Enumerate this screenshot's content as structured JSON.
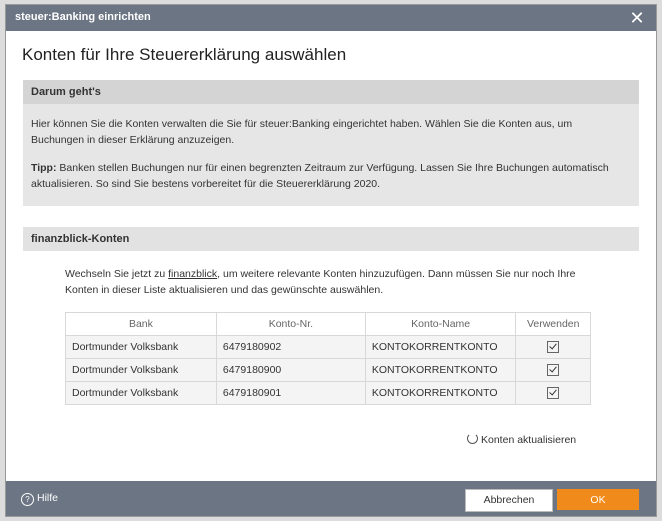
{
  "window": {
    "title": "steuer:Banking einrichten",
    "close_glyph": "✕"
  },
  "heading": "Konten für Ihre Steuererklärung auswählen",
  "section_info": {
    "title": "Darum geht's",
    "paragraph1": "Hier können Sie die Konten verwalten die Sie für steuer:Banking eingerichtet haben. Wählen Sie die Konten aus, um Buchungen in dieser Erklärung anzuzeigen.",
    "tip_label": "Tipp:",
    "tip_text": " Banken stellen Buchungen nur für einen begrenzten Zeitraum zur Verfügung. Lassen Sie Ihre Buchungen automatisch aktualisieren. So sind Sie bestens vorbereitet für die Steuererklärung 2020."
  },
  "section_accounts": {
    "title": "finanzblick-Konten",
    "intro_before": "Wechseln Sie jetzt zu ",
    "intro_link": "finanzblick",
    "intro_after": ", um weitere relevante Konten hinzuzufügen. Dann müssen Sie nur noch Ihre Konten in dieser Liste aktualisieren und das gewünschte auswählen.",
    "columns": [
      "Bank",
      "Konto-Nr.",
      "Konto-Name",
      "Verwenden"
    ],
    "rows": [
      {
        "bank": "Dortmunder Volksbank",
        "number": "6479180902",
        "name": "KONTOKORRENTKONTO",
        "use": true
      },
      {
        "bank": "Dortmunder Volksbank",
        "number": "6479180900",
        "name": "KONTOKORRENTKONTO",
        "use": true
      },
      {
        "bank": "Dortmunder Volksbank",
        "number": "6479180901",
        "name": "KONTOKORRENTKONTO",
        "use": true
      }
    ]
  },
  "refresh_label": "Konten aktualisieren",
  "footer": {
    "help_glyph": "?",
    "help_label": "Hilfe",
    "cancel_label": "Abbrechen",
    "ok_label": "OK"
  },
  "colors": {
    "titlebar": "#6b7583",
    "accent": "#f08a1a"
  },
  "icons": {
    "close": "close-icon",
    "refresh": "refresh-icon",
    "help": "help-icon",
    "checkbox": "checkbox-checked-icon"
  }
}
